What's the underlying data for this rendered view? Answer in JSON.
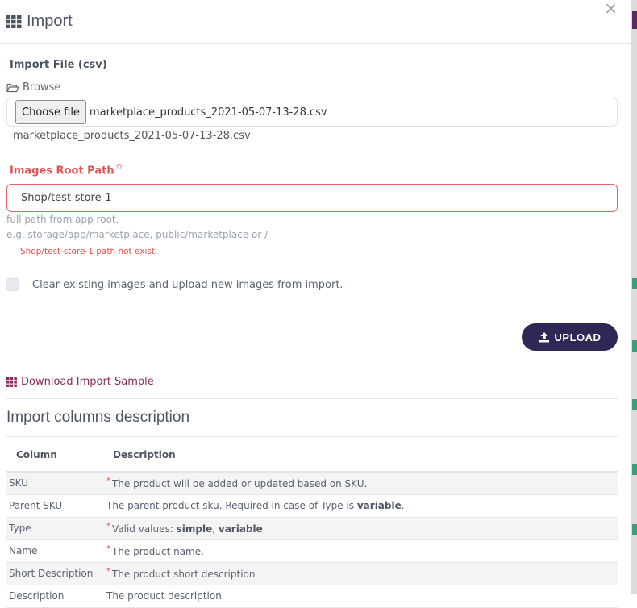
{
  "modal": {
    "title": "Import",
    "close": "×"
  },
  "form": {
    "import_file_label": "Import File (csv)",
    "browse_label": "Browse",
    "choose_button": "Choose file",
    "chosen_file": "marketplace_products_2021-05-07-13-28.csv",
    "file_name_display": "marketplace_products_2021-05-07-13-28.csv",
    "images_root_label": "Images Root Path",
    "images_root_required": "✩",
    "images_root_value": "Shop/test-store-1",
    "help_line1": "full path from app root.",
    "help_line2": "e.g. storage/app/marketplace, public/marketplace or /",
    "error_message": "Shop/test-store-1 path not exist.",
    "clear_images_label": "Clear existing images and upload new images from import.",
    "clear_images_checked": false,
    "upload_button": "UPLOAD"
  },
  "download_sample_link": "Download Import Sample",
  "columns_section": {
    "title": "Import columns description",
    "headers": [
      "Column",
      "Description"
    ],
    "rows": [
      {
        "column": "SKU",
        "required": "*",
        "desc_pre": "The product will be added or updated based on SKU.",
        "desc_b1": "",
        "desc_mid": "",
        "desc_b2": "",
        "desc_post": ""
      },
      {
        "column": "Parent SKU",
        "required": "",
        "desc_pre": "The parent product sku. Required in case of Type is ",
        "desc_b1": "variable",
        "desc_mid": "",
        "desc_b2": "",
        "desc_post": "."
      },
      {
        "column": "Type",
        "required": "*",
        "desc_pre": "Valid values: ",
        "desc_b1": "simple",
        "desc_mid": ", ",
        "desc_b2": "variable",
        "desc_post": ""
      },
      {
        "column": "Name",
        "required": "*",
        "desc_pre": "The product name.",
        "desc_b1": "",
        "desc_mid": "",
        "desc_b2": "",
        "desc_post": ""
      },
      {
        "column": "Short Description",
        "required": "*",
        "desc_pre": "The product short description",
        "desc_b1": "",
        "desc_mid": "",
        "desc_b2": "",
        "desc_post": ""
      },
      {
        "column": "Description",
        "required": "",
        "desc_pre": "The product description",
        "desc_b1": "",
        "desc_mid": "",
        "desc_b2": "",
        "desc_post": ""
      }
    ]
  },
  "colors": {
    "primary_button": "#2e2856",
    "error": "#e05252",
    "link": "#8a2a5e"
  },
  "icons": {
    "title_icon": "grid-icon",
    "browse_icon": "folder-open-icon",
    "upload_icon": "upload-icon",
    "download_icon": "grid-icon"
  }
}
